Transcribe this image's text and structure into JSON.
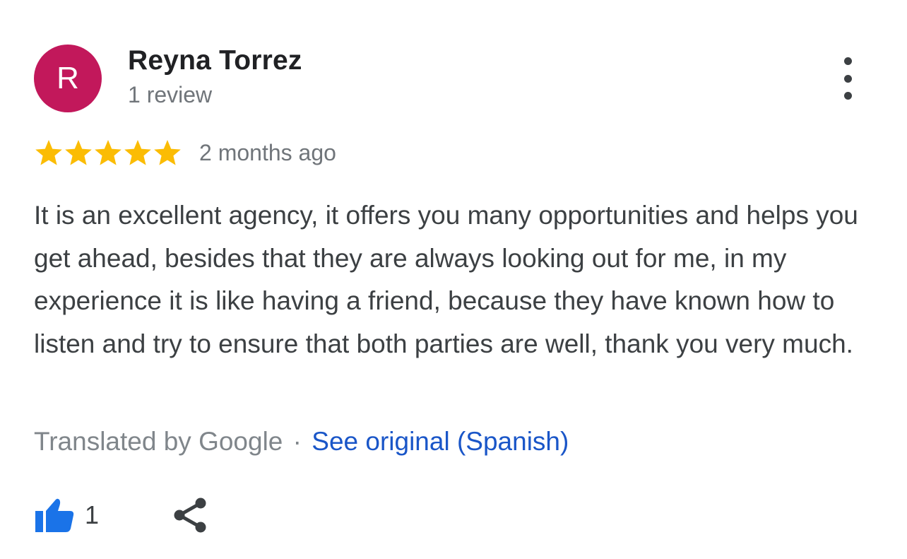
{
  "review": {
    "author": {
      "initial": "R",
      "name": "Reyna Torrez",
      "meta": "1 review",
      "avatar_color": "#c2185b"
    },
    "rating": {
      "stars": 5,
      "max": 5,
      "star_color": "#fbbc04"
    },
    "date": "2 months ago",
    "text": "It is an excellent agency, it offers you many opportunities and helps you get ahead, besides that they are always looking out for me, in my experience it is like having a friend, because they have known how to listen and try to ensure that both parties are well, thank you very much.",
    "translation": {
      "label": "Translated by Google",
      "separator": "·",
      "link": "See original (Spanish)"
    },
    "actions": {
      "like_count": "1",
      "like_icon": "thumbs-up-icon",
      "share_icon": "share-icon",
      "more_icon": "more-vert-icon",
      "like_color": "#1a73e8"
    }
  }
}
